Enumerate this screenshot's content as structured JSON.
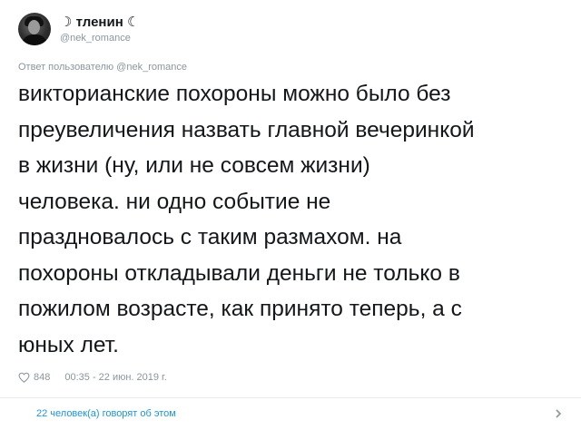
{
  "user": {
    "display_name": "☽ тленин ☾",
    "handle": "@nek_romance"
  },
  "reply": {
    "prefix": "Ответ пользователю ",
    "mention": "@nek_romance"
  },
  "tweet": {
    "lines": [
      "викторианские похороны можно было без",
      "преувеличения назвать главной вечеринкой",
      "в жизни (ну, или не совсем жизни)",
      "человека. ни одно событие не",
      "праздновалось с таким размахом. на",
      "похороны откладывали деньги не только в",
      "пожилом возрасте, как принято теперь, а с",
      "юных лет."
    ]
  },
  "meta": {
    "likes": "848",
    "timestamp": "00:35 - 22 июн. 2019 г."
  },
  "footer": {
    "talking": "22 человек(а) говорят об этом"
  },
  "colors": {
    "text": "#14171a",
    "muted": "#8a959e",
    "link": "#1b95e0",
    "divider": "#e6ecf0"
  },
  "icons": {
    "like": "heart-icon",
    "more": "chevron-right-icon"
  }
}
